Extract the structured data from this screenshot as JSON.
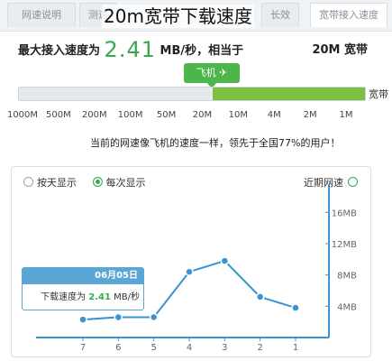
{
  "heading": "20m宽带下载速度",
  "tabs": [
    "网速说明",
    "测速",
    "长效",
    "宽带接入速度"
  ],
  "speed": {
    "label": "最大接入速度为",
    "value": "2.41",
    "unit": "MB/秒，相当于",
    "bandwidth": "20M 宽带"
  },
  "plane_badge": "飞机",
  "meter": {
    "label": "宽带",
    "fill_fraction": 0.44
  },
  "scale": [
    "1000M",
    "500M",
    "200M",
    "100M",
    "50M",
    "20M",
    "10M",
    "4M",
    "2M",
    "1M"
  ],
  "rank_text": "当前的网速像飞机的速度一样，领先于全国77%的用户！",
  "options": {
    "daily": "每次显示",
    "each": "按天显示"
  },
  "recent_label": "近期网速",
  "tooltip": {
    "date": "06月05日",
    "label": "下载速度为",
    "value": "2.41",
    "unit": "MB/秒"
  },
  "chart_data": {
    "type": "line",
    "x": [
      "7",
      "6",
      "5",
      "4",
      "3",
      "2",
      "1"
    ],
    "values": [
      2.3,
      2.6,
      2.6,
      8.4,
      9.8,
      5.2,
      3.8
    ],
    "ylim": [
      0,
      18
    ],
    "yticks": [
      "4MB",
      "8MB",
      "12MB",
      "16MB"
    ],
    "ytick_values": [
      4,
      8,
      12,
      16
    ],
    "color": "#3b94d2",
    "grid": false
  }
}
